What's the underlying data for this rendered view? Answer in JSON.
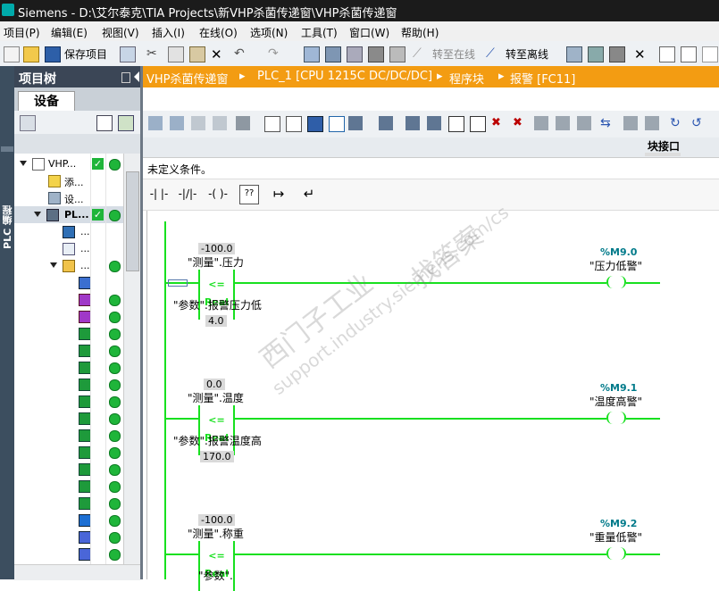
{
  "window": {
    "title": "Siemens  -  D:\\艾尔泰克\\TIA  Projects\\新VHP杀菌传递窗\\VHP杀菌传递窗"
  },
  "menu": [
    "项目(P)",
    "编辑(E)",
    "视图(V)",
    "插入(I)",
    "在线(O)",
    "选项(N)",
    "工具(T)",
    "窗口(W)",
    "帮助(H)"
  ],
  "toolbar": {
    "save_project": "保存项目",
    "go_online": "转至在线",
    "go_offline": "转至离线"
  },
  "left_strip": {
    "label": "PLC 编程"
  },
  "project_tree": {
    "title": "项目树",
    "tab": "设备",
    "items": [
      {
        "label": "VHP...",
        "status": "ok"
      },
      {
        "label": "添...",
        "status": ""
      },
      {
        "label": "设...",
        "status": ""
      },
      {
        "label": "PL...",
        "status": "ok"
      },
      {
        "label": "...",
        "status": ""
      },
      {
        "label": "...",
        "status": ""
      },
      {
        "label": "...",
        "status": "ok"
      },
      {
        "label": "",
        "status": ""
      },
      {
        "label": "",
        "status": "ok"
      },
      {
        "label": "",
        "status": "ok"
      },
      {
        "label": "",
        "status": "ok"
      },
      {
        "label": "",
        "status": "ok"
      },
      {
        "label": "",
        "status": "ok"
      },
      {
        "label": "",
        "status": "ok"
      },
      {
        "label": "",
        "status": "ok"
      },
      {
        "label": "",
        "status": "ok"
      },
      {
        "label": "",
        "status": "ok"
      },
      {
        "label": "",
        "status": "ok"
      },
      {
        "label": "",
        "status": "ok"
      },
      {
        "label": "",
        "status": "ok"
      },
      {
        "label": "",
        "status": "ok"
      },
      {
        "label": "",
        "status": "ok"
      },
      {
        "label": "",
        "status": "ok"
      },
      {
        "label": "",
        "status": "ok"
      }
    ]
  },
  "breadcrumb": [
    "VHP杀菌传递窗",
    "PLC_1 [CPU 1215C DC/DC/DC]",
    "程序块",
    "报警 [FC11]"
  ],
  "editor": {
    "interface_label": "块接口",
    "condition_text": "未定义条件。",
    "ladder_tools": [
      "-| |-",
      "-|/|-",
      "-( )-",
      "??",
      "↦",
      "↵"
    ]
  },
  "networks": [
    {
      "in1_value": "-100.0",
      "in1_tag": "\"测量\".压力",
      "op": "<=",
      "type": "Real",
      "in2_tag": "\"参数\".报警压力低",
      "in2_value": "4.0",
      "coil_addr": "%M9.0",
      "coil_tag": "\"压力低警\""
    },
    {
      "in1_value": "0.0",
      "in1_tag": "\"测量\".温度",
      "op": "<=",
      "type": "Real",
      "in2_tag": "\"参数\".报警温度高",
      "in2_value": "170.0",
      "coil_addr": "%M9.1",
      "coil_tag": "\"温度高警\""
    },
    {
      "in1_value": "-100.0",
      "in1_tag": "\"测量\".称重",
      "op": "<=",
      "type": "Real",
      "in2_tag": "\"参数\".",
      "in2_value": "",
      "coil_addr": "%M9.2",
      "coil_tag": "\"重量低警\""
    }
  ],
  "watermark": {
    "line1": "西门子工业",
    "line2": "找答案",
    "line3": "support.industry.siemens.com/cs"
  }
}
